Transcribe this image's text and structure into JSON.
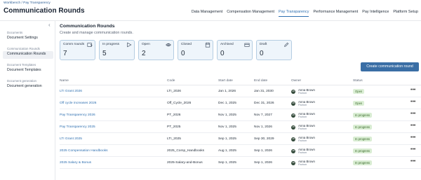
{
  "header": {
    "breadcrumb": "Workbench / Pay Transparency",
    "title": "Communication Rounds",
    "nav": [
      "Data Management",
      "Compensation Management",
      "Pay Transparency",
      "Performance Management",
      "Pay Intelligence",
      "Platform Setup"
    ],
    "active_nav": "Pay Transparency"
  },
  "sidebar": {
    "groups": [
      {
        "caption": "Documents",
        "link": "Document Settings"
      },
      {
        "caption": "Communication Rounds",
        "link": "Communication Rounds"
      },
      {
        "caption": "Document Templates",
        "link": "Document Templates"
      },
      {
        "caption": "Document generation",
        "link": "Document generation"
      }
    ],
    "selected": "Communication Rounds"
  },
  "main": {
    "title": "Communication Rounds",
    "subtitle": "Create and manage communication rounds.",
    "create_label": "Create communication round"
  },
  "cards": [
    {
      "label": "Comm rounds",
      "value": "7",
      "icon": "rounds-icon"
    },
    {
      "label": "In progress",
      "value": "5",
      "icon": "play-icon"
    },
    {
      "label": "Open",
      "value": "2",
      "icon": "eye-icon"
    },
    {
      "label": "Closed",
      "value": "0",
      "icon": "calendar-icon"
    },
    {
      "label": "Archived",
      "value": "0",
      "icon": "archive-icon"
    },
    {
      "label": "Draft",
      "value": "0",
      "icon": "pencil-icon"
    }
  ],
  "table": {
    "columns": [
      "Name",
      "Code",
      "Start date",
      "End date",
      "Owner",
      "Status"
    ],
    "rows": [
      {
        "name": "LTI Grant 2026",
        "code": "LTI_2026",
        "start": "Jan 1, 2026",
        "end": "Jan 31, 2030",
        "owner": "Anna Brown",
        "role": "Partner",
        "status": "Open"
      },
      {
        "name": "Off cycle increases 2026",
        "code": "Off_Cycle_2026",
        "start": "Dec 1, 2025",
        "end": "Dec 31, 2026",
        "owner": "Anna Brown",
        "role": "Partner",
        "status": "Open"
      },
      {
        "name": "Pay Transparency 2026",
        "code": "PT_2026",
        "start": "Nov 1, 2025",
        "end": "Nov 7, 2027",
        "owner": "Anna Brown",
        "role": "Partner",
        "status": "In progress"
      },
      {
        "name": "Pay Transparency 2025",
        "code": "PT_2025",
        "start": "Nov 1, 2025",
        "end": "Nov 1, 2026",
        "owner": "Anna Brown",
        "role": "Partner",
        "status": "In progress"
      },
      {
        "name": "LTI Grant 2025",
        "code": "LTI_2025",
        "start": "Sep 1, 2025",
        "end": "Sep 30, 2029",
        "owner": "Anna Brown",
        "role": "Partner",
        "status": "In progress"
      },
      {
        "name": "2025 Compensation Handbooks",
        "code": "2025_Comp_Handbooks",
        "start": "Aug 1, 2025",
        "end": "Sep 1, 2026",
        "owner": "Anna Brown",
        "role": "Partner",
        "status": "In progress"
      },
      {
        "name": "2025 Salary & Bonus",
        "code": "2025-Salary-and-Bonus",
        "start": "Sep 1, 2025",
        "end": "Sep 1, 2026",
        "owner": "Anna Brown",
        "role": "Partner",
        "status": "In progress"
      }
    ]
  },
  "colors": {
    "accent": "#2e6fb0",
    "button": "#3a6ea5",
    "card_bg": "#eef5fb",
    "badge_bg": "#dcefd6"
  }
}
